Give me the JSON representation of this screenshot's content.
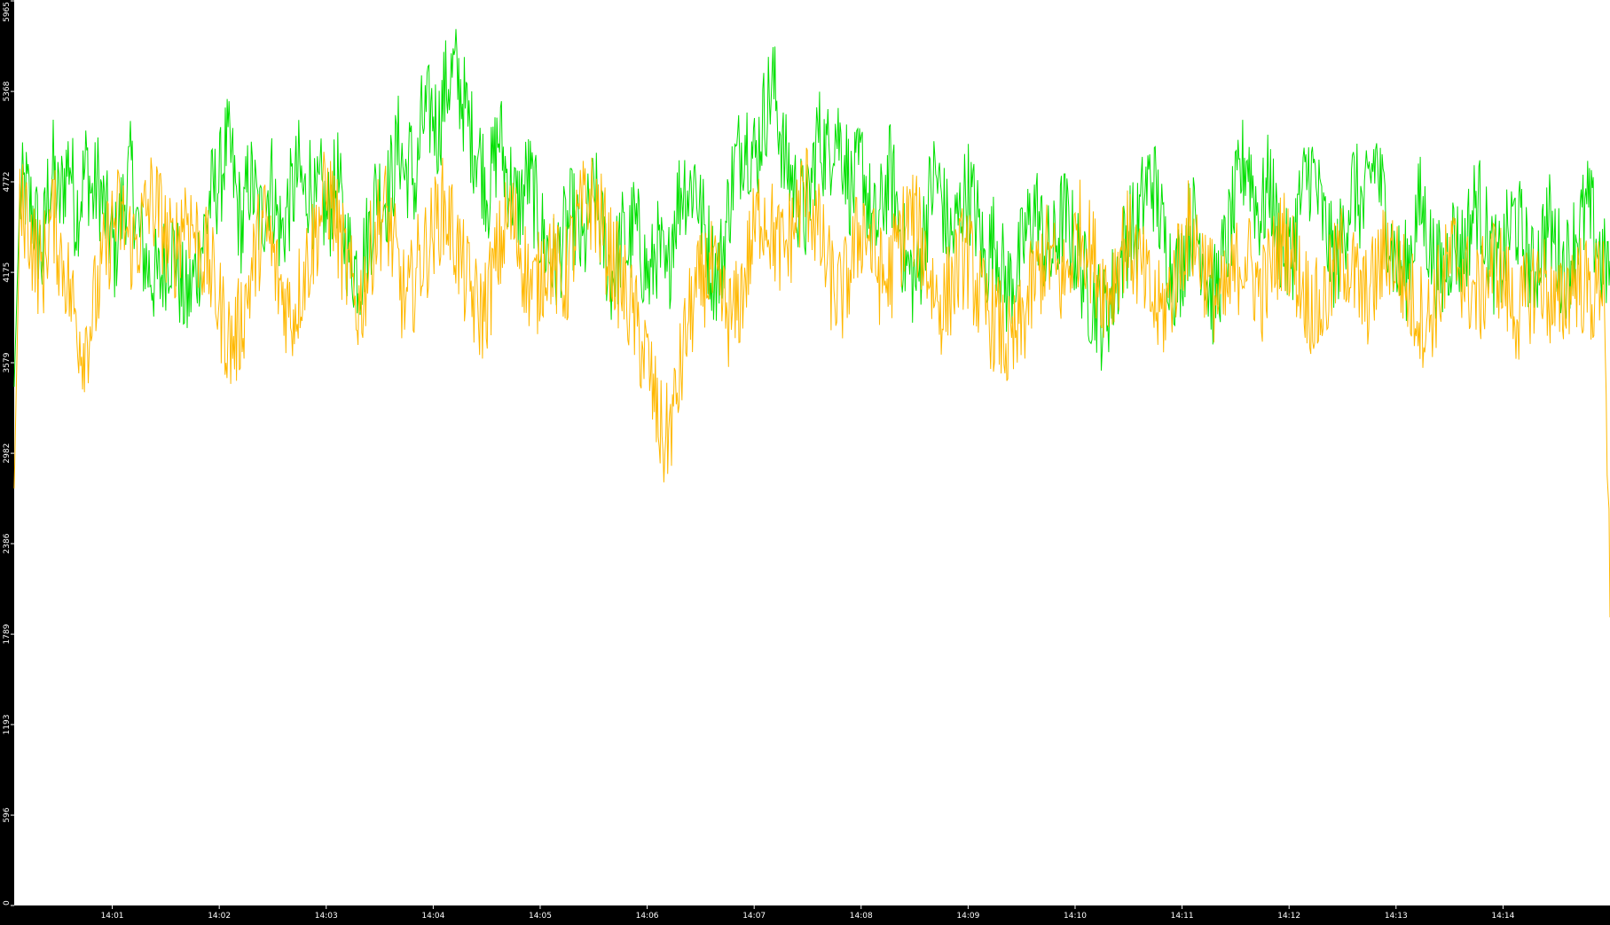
{
  "chart_data": {
    "type": "line",
    "title": "",
    "xlabel": "",
    "ylabel": "",
    "x_ticks": [
      "14:01",
      "14:02",
      "14:03",
      "14:04",
      "14:05",
      "14:06",
      "14:07",
      "14:08",
      "14:09",
      "14:10",
      "14:11",
      "14:12",
      "14:13",
      "14:14"
    ],
    "y_ticks": [
      "0",
      "596",
      "1193",
      "1789",
      "2386",
      "2982",
      "3579",
      "4175",
      "4772",
      "5368",
      "5965"
    ],
    "ylim": [
      0,
      5965
    ],
    "xlim": [
      "14:00:05",
      "14:15:00"
    ],
    "grid": false,
    "legend": "none",
    "colors": {
      "background": "#ffffff",
      "axis_background": "#000000",
      "axis_text": "#ffffff"
    },
    "series": [
      {
        "color": "#00e000",
        "x_start": "14:00:05",
        "x_end": "14:15:00",
        "values": [
          3420,
          4650,
          4720,
          4600,
          4480,
          4250,
          4700,
          4850,
          4600,
          4800,
          4950,
          4550,
          4700,
          4900,
          4650,
          4780,
          4600,
          4450,
          4300,
          4520,
          4700,
          4850,
          4500,
          4330,
          4200,
          4150,
          4100,
          4250,
          4350,
          4280,
          4050,
          3980,
          4100,
          4250,
          4420,
          4650,
          4720,
          4800,
          5020,
          4900,
          4600,
          4450,
          4800,
          4700,
          4500,
          4620,
          4820,
          4550,
          4420,
          4600,
          4700,
          4850,
          4650,
          4800,
          4550,
          4720,
          4500,
          4660,
          4800,
          4450,
          4300,
          4220,
          4180,
          4350,
          4500,
          4750,
          4650,
          4700,
          4850,
          5050,
          4800,
          4920,
          4700,
          5150,
          5200,
          5250,
          5100,
          5350,
          5450,
          5500,
          5380,
          5220,
          5060,
          5000,
          4850,
          4700,
          4900,
          5100,
          4850,
          4760,
          4600,
          4650,
          4820,
          4700,
          4500,
          4380,
          4280,
          4200,
          4350,
          4450,
          4550,
          4420,
          4300,
          4550,
          4700,
          4480,
          4320,
          4150,
          4250,
          4400,
          4320,
          4500,
          4380,
          4220,
          4100,
          4350,
          4250,
          4050,
          4500,
          4650,
          4780,
          4700,
          4820,
          4550,
          4420,
          4230,
          4150,
          4300,
          4600,
          4850,
          4960,
          5100,
          5000,
          4920,
          5150,
          5300,
          5420,
          5200,
          4900,
          4850,
          4700,
          4620,
          4520,
          4800,
          5100,
          5000,
          4950,
          5150,
          5050,
          4920,
          4700,
          4780,
          4900,
          4650,
          4450,
          4500,
          4700,
          4830,
          4650,
          4400,
          4200,
          4150,
          4100,
          4450,
          4650,
          4820,
          4700,
          4500,
          4380,
          4500,
          4650,
          4720,
          4600,
          4450,
          4200,
          4350,
          4400,
          4200,
          4050,
          4150,
          4200,
          4380,
          4500,
          4620,
          4450,
          4300,
          4280,
          4420,
          4560,
          4480,
          4350,
          4250,
          4100,
          4000,
          3980,
          3850,
          3950,
          4050,
          4200,
          4350,
          4480,
          4400,
          4600,
          4750,
          4800,
          4620,
          4400,
          4250,
          4150,
          4200,
          4380,
          4520,
          4450,
          4320,
          4100,
          4000,
          4150,
          4300,
          4480,
          4650,
          4850,
          4950,
          4750,
          4550,
          4620,
          4800,
          4520,
          4350,
          4250,
          4300,
          4550,
          4700,
          4860,
          4800,
          4600,
          4450,
          4300,
          4250,
          4400,
          4600,
          4750,
          4650,
          4550,
          4800,
          4950,
          4700,
          4550,
          4320,
          4200,
          4150,
          4250,
          4480,
          4620,
          4500,
          4300,
          4200,
          4150,
          4280,
          4420,
          4300,
          4350,
          4500,
          4650,
          4580,
          4380,
          4250,
          4180,
          4300,
          4450,
          4550,
          4430,
          4300,
          4150,
          4250,
          4400,
          4520,
          4380,
          4260,
          4200,
          4300,
          4450,
          4500,
          4600,
          4480,
          4320,
          4200,
          4250
        ]
      },
      {
        "color": "#ffb800",
        "x_start": "14:00:05",
        "x_end": "14:15:00",
        "values": [
          2750,
          4550,
          4600,
          4400,
          4250,
          4180,
          4450,
          4550,
          4300,
          4200,
          4000,
          3850,
          3700,
          3780,
          3950,
          4100,
          4300,
          4450,
          4550,
          4520,
          4400,
          4350,
          4420,
          4550,
          4650,
          4600,
          4500,
          4350,
          4300,
          4450,
          4600,
          4520,
          4400,
          4300,
          4250,
          4100,
          3950,
          3820,
          3700,
          3750,
          3880,
          4050,
          4220,
          4400,
          4480,
          4350,
          4150,
          4050,
          3950,
          3900,
          4050,
          4200,
          4320,
          4450,
          4600,
          4700,
          4600,
          4400,
          4250,
          4100,
          3950,
          4000,
          4200,
          4400,
          4500,
          4600,
          4450,
          4250,
          4050,
          3950,
          4100,
          4250,
          4300,
          4400,
          4500,
          4600,
          4550,
          4450,
          4300,
          4150,
          4050,
          3950,
          3900,
          4000,
          4150,
          4300,
          4450,
          4550,
          4450,
          4300,
          4150,
          4050,
          4100,
          4250,
          4300,
          4200,
          4100,
          4150,
          4350,
          4500,
          4600,
          4650,
          4600,
          4500,
          4350,
          4250,
          4150,
          4050,
          3950,
          3850,
          3700,
          3600,
          3400,
          3200,
          3050,
          3150,
          3300,
          3550,
          3800,
          3950,
          4050,
          4150,
          4200,
          4100,
          4000,
          3900,
          3850,
          3950,
          4100,
          4300,
          4450,
          4600,
          4550,
          4450,
          4350,
          4300,
          4400,
          4500,
          4650,
          4720,
          4600,
          4450,
          4300,
          4150,
          4050,
          4000,
          4100,
          4250,
          4400,
          4500,
          4400,
          4250,
          4150,
          4100,
          4200,
          4350,
          4450,
          4550,
          4500,
          4400,
          4250,
          4100,
          4000,
          3950,
          4050,
          4150,
          4250,
          4300,
          4200,
          4050,
          3950,
          3900,
          3850,
          3800,
          3700,
          3650,
          3750,
          3850,
          4000,
          4100,
          4200,
          4300,
          4250,
          4150,
          4100,
          4200,
          4350,
          4450,
          4400,
          4300,
          4200,
          4100,
          4050,
          4150,
          4300,
          4400,
          4350,
          4250,
          4150,
          4050,
          3950,
          3900,
          3950,
          4050,
          4200,
          4350,
          4450,
          4400,
          4300,
          4200,
          4100,
          4000,
          3950,
          4050,
          4150,
          4250,
          4300,
          4200,
          4100,
          4050,
          4150,
          4250,
          4350,
          4400,
          4300,
          4200,
          4100,
          4000,
          3950,
          3900,
          4000,
          4100,
          4200,
          4300,
          4250,
          4150,
          4050,
          4000,
          4050,
          4150,
          4250,
          4350,
          4300,
          4200,
          4100,
          4000,
          3950,
          3900,
          3850,
          3950,
          4050,
          4150,
          4250,
          4300,
          4200,
          4100,
          4050,
          4000,
          4100,
          4200,
          4250,
          4150,
          4050,
          3950,
          3900,
          3950,
          4050,
          4100,
          4150,
          4050,
          3950,
          3900,
          4000,
          4100,
          4150,
          4100,
          4050,
          4000,
          4100,
          4200,
          1900
        ]
      }
    ]
  }
}
